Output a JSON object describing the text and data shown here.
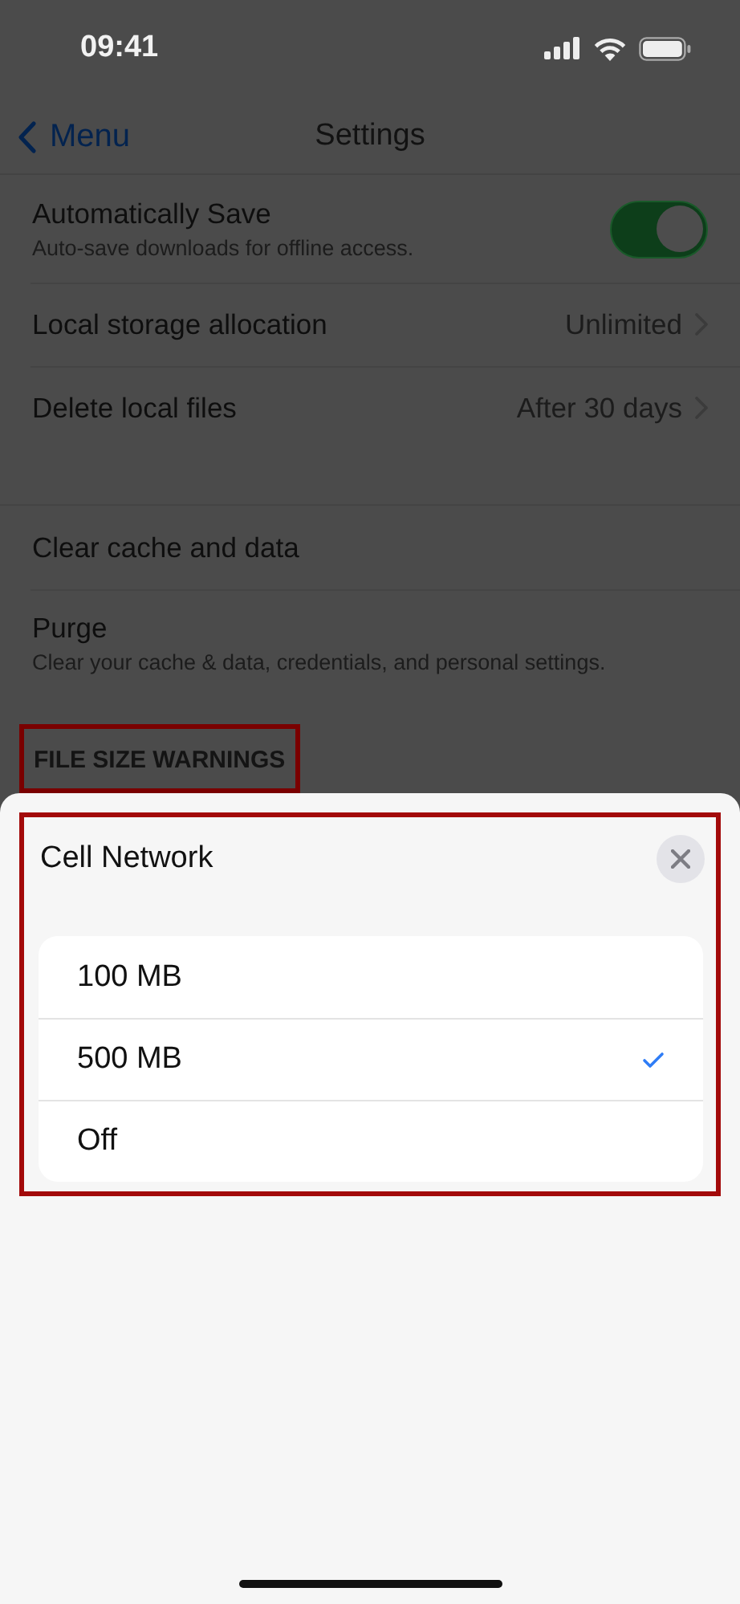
{
  "status_bar": {
    "time": "09:41"
  },
  "nav": {
    "back_label": "Menu",
    "title": "Settings"
  },
  "groups": [
    {
      "rows": [
        {
          "kind": "toggle",
          "label": "Automatically Save",
          "subtitle": "Auto-save downloads for offline access.",
          "on": true
        },
        {
          "kind": "value",
          "label": "Local storage allocation",
          "value": "Unlimited"
        },
        {
          "kind": "value",
          "label": "Delete local files",
          "value": "After 30 days"
        }
      ]
    },
    {
      "rows": [
        {
          "kind": "action",
          "label": "Clear cache and data"
        },
        {
          "kind": "action",
          "label": "Purge",
          "subtitle": "Clear your cache & data, credentials, and personal settings."
        }
      ]
    }
  ],
  "section_header": {
    "text": "FILE SIZE WARNINGS",
    "highlighted": true
  },
  "sheet": {
    "title": "Cell Network",
    "highlighted": true,
    "options": [
      {
        "label": "100 MB",
        "selected": false
      },
      {
        "label": "500 MB",
        "selected": true
      },
      {
        "label": "Off",
        "selected": false
      }
    ]
  }
}
